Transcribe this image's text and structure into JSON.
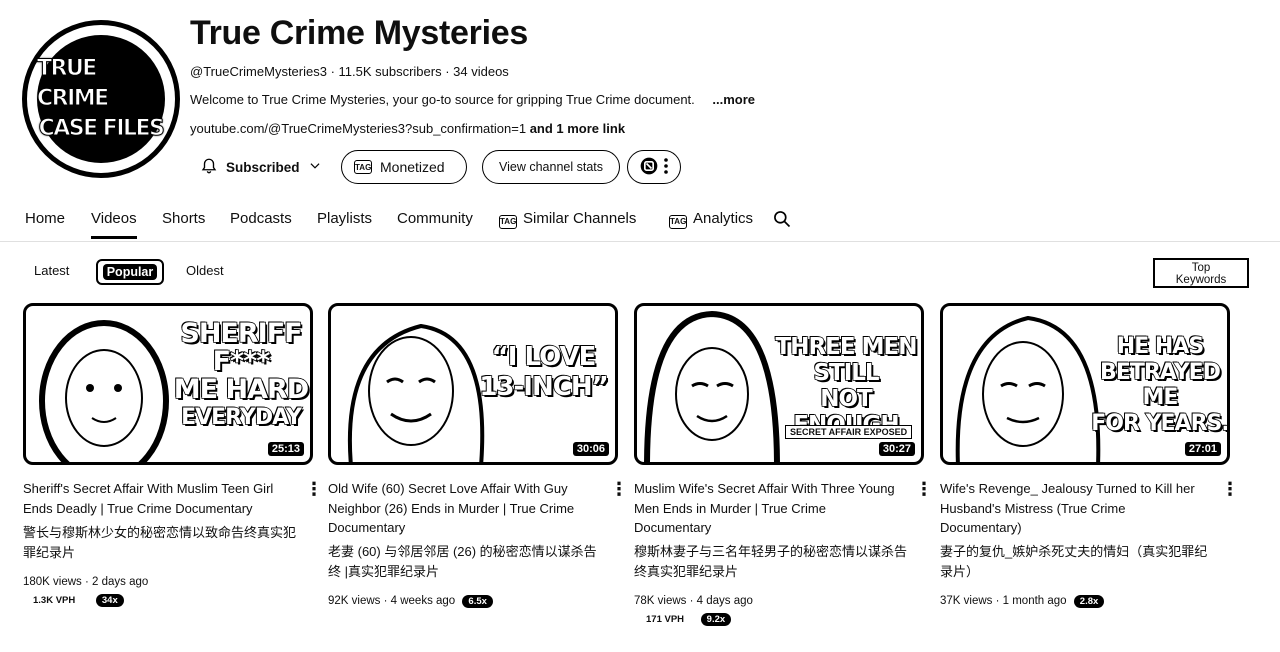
{
  "channel": {
    "logo_lines": [
      "TRUE CRIME",
      "CASE FILES"
    ],
    "name": "True Crime Mysteries",
    "meta": "@TrueCrimeMysteries3 · 11.5K subscribers · 34 videos",
    "description": "Welcome to True Crime Mysteries, your go-to source for gripping True Crime document.",
    "more": "...more",
    "link": "youtube.com/@TrueCrimeMysteries3?sub_confirmation=1",
    "link_extra": "and 1 more link"
  },
  "buttons": {
    "subscribed": "Subscribed",
    "monetized": "Monetized",
    "stats": "View channel stats",
    "tag_icon_text": "TAG"
  },
  "tabs": [
    "Home",
    "Videos",
    "Shorts",
    "Podcasts",
    "Playlists",
    "Community",
    "Similar Channels",
    "Analytics"
  ],
  "active_tab": "Videos",
  "chips": [
    "Latest",
    "Popular",
    "Oldest"
  ],
  "active_chip": "Popular",
  "top_keywords": [
    "Top",
    "Keywords"
  ],
  "videos": [
    {
      "overlay": [
        "SHERIFF",
        "F***",
        "ME HARD",
        "EVERYDAY"
      ],
      "duration": "25:13",
      "title": "Sheriff's Secret Affair With Muslim Teen Girl Ends Deadly | True Crime Documentary",
      "title_zh": "警长与穆斯林少女的秘密恋情以致命告终真实犯罪纪录片",
      "stats": "180K views · 2 days ago",
      "vph": "1.3K VPH",
      "badge": "34x"
    },
    {
      "overlay": [
        "“I LOVE",
        "13-INCH”"
      ],
      "duration": "30:06",
      "title": "Old Wife (60) Secret Love Affair With Guy Neighbor (26) Ends in Murder | True Crime Documentary",
      "title_zh": "老妻 (60) 与邻居邻居 (26) 的秘密恋情以谋杀告终 |真实犯罪纪录片",
      "stats": "92K views · 4 weeks ago",
      "vph": "",
      "badge": "6.5x"
    },
    {
      "overlay": [
        "THREE MEN",
        "STILL",
        "NOT ENOUGH"
      ],
      "sub_overlay": "SECRET AFFAIR EXPOSED",
      "duration": "30:27",
      "title": "Muslim Wife's Secret Affair With Three Young Men Ends in Murder | True Crime Documentary",
      "title_zh": "穆斯林妻子与三名年轻男子的秘密恋情以谋杀告终真实犯罪纪录片",
      "stats": "78K views · 4 days ago",
      "vph": "171 VPH",
      "badge": "9.2x"
    },
    {
      "overlay": [
        "HE HAS",
        "BETRAYED",
        "ME",
        "FOR YEARS."
      ],
      "duration": "27:01",
      "title": "Wife's Revenge_ Jealousy Turned to Kill her Husband's Mistress (True Crime Documentary)",
      "title_zh": "妻子的复仇_嫉妒杀死丈夫的情妇（真实犯罪纪录片）",
      "stats": "37K views · 1 month ago",
      "vph": "",
      "badge": "2.8x"
    }
  ]
}
